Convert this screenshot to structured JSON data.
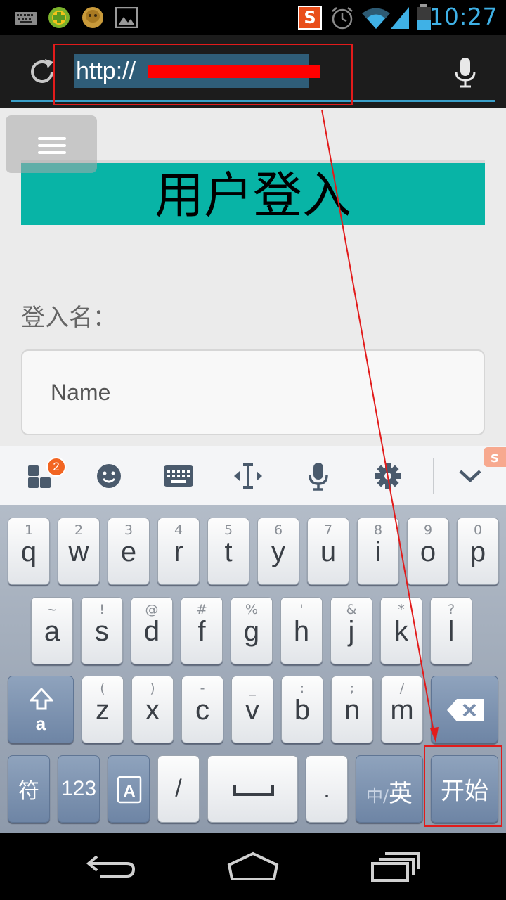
{
  "status_bar": {
    "time": "10:27",
    "left_icons": [
      "keyboard-icon",
      "game-icon",
      "avatar-icon",
      "image-icon"
    ],
    "right_icons": [
      "sogou-icon",
      "alarm-icon",
      "wifi-icon",
      "signal-icon",
      "battery-icon"
    ],
    "sogou_letter": "S"
  },
  "browser": {
    "url_text": "http://",
    "url_redacted": true,
    "icons": [
      "refresh-icon",
      "mic-icon"
    ]
  },
  "page": {
    "title": "用户登入",
    "username_label": "登入名：",
    "name_placeholder": "Name",
    "banner_color": "#08b4a6"
  },
  "ime_toolbar": {
    "badge_count": "2",
    "buttons": [
      "apps-icon",
      "emoji-icon",
      "keyboard-icon",
      "cursor-icon",
      "mic-icon",
      "settings-icon",
      "collapse-icon"
    ],
    "sogou_mark": "s"
  },
  "keyboard": {
    "row1": [
      {
        "hint": "1",
        "main": "q"
      },
      {
        "hint": "2",
        "main": "w"
      },
      {
        "hint": "3",
        "main": "e"
      },
      {
        "hint": "4",
        "main": "r"
      },
      {
        "hint": "5",
        "main": "t"
      },
      {
        "hint": "6",
        "main": "y"
      },
      {
        "hint": "7",
        "main": "u"
      },
      {
        "hint": "8",
        "main": "i"
      },
      {
        "hint": "9",
        "main": "o"
      },
      {
        "hint": "0",
        "main": "p"
      }
    ],
    "row2": [
      {
        "hint": "~",
        "main": "a"
      },
      {
        "hint": "!",
        "main": "s"
      },
      {
        "hint": "@",
        "main": "d"
      },
      {
        "hint": "#",
        "main": "f"
      },
      {
        "hint": "%",
        "main": "g"
      },
      {
        "hint": "'",
        "main": "h"
      },
      {
        "hint": "&",
        "main": "j"
      },
      {
        "hint": "*",
        "main": "k"
      },
      {
        "hint": "?",
        "main": "l"
      }
    ],
    "row3": [
      {
        "hint": "(",
        "main": "z"
      },
      {
        "hint": ")",
        "main": "x"
      },
      {
        "hint": "-",
        "main": "c"
      },
      {
        "hint": "_",
        "main": "v"
      },
      {
        "hint": ":",
        "main": "b"
      },
      {
        "hint": ";",
        "main": "n"
      },
      {
        "hint": "/",
        "main": "m"
      }
    ],
    "shift_letter": "a",
    "symbols_label": "符",
    "numbers_label": "123",
    "slash_label": "/",
    "period_label": ".",
    "lang_zh": "中/",
    "lang_en": "英",
    "start_label": "开始"
  },
  "nav_bar": {
    "buttons": [
      "back-icon",
      "home-icon",
      "recents-icon"
    ]
  },
  "colors": {
    "accent": "#3a9fc8",
    "annotation_red": "#e21b1b"
  }
}
